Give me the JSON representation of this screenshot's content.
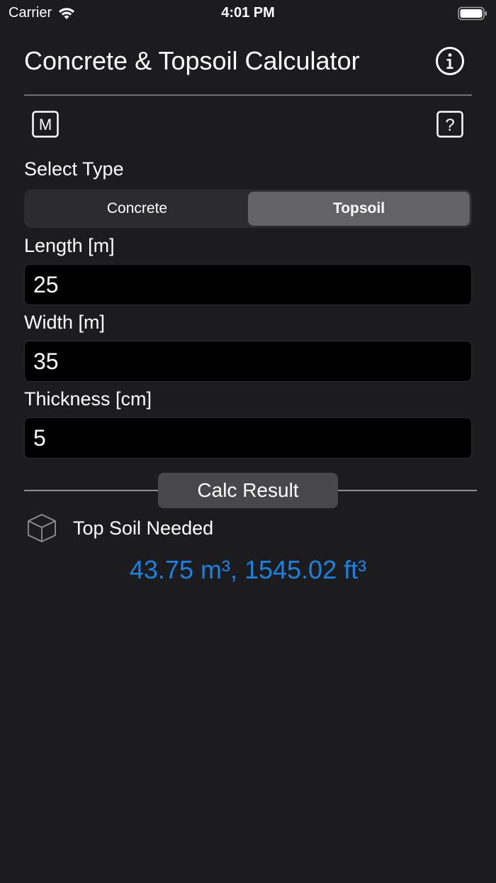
{
  "status_bar": {
    "carrier": "Carrier",
    "time": "4:01 PM"
  },
  "header": {
    "title": "Concrete & Topsoil Calculator",
    "info_icon": "info-circle-icon"
  },
  "toolbar": {
    "m_label": "M",
    "help_label": "?"
  },
  "type_selector": {
    "label": "Select Type",
    "options": [
      "Concrete",
      "Topsoil"
    ],
    "selected": "Topsoil"
  },
  "fields": {
    "length": {
      "label": "Length [m]",
      "value": "25"
    },
    "width": {
      "label": "Width [m]",
      "value": "35"
    },
    "thickness": {
      "label": "Thickness [cm]",
      "value": "5"
    }
  },
  "calc": {
    "button_label": "Calc Result"
  },
  "result": {
    "icon": "cube-icon",
    "label": "Top Soil Needed",
    "value": "43.75 m³, 1545.02 ft³"
  },
  "colors": {
    "background": "#1c1c1e",
    "accent": "#1a82e2",
    "segment_selected": "#636366"
  }
}
